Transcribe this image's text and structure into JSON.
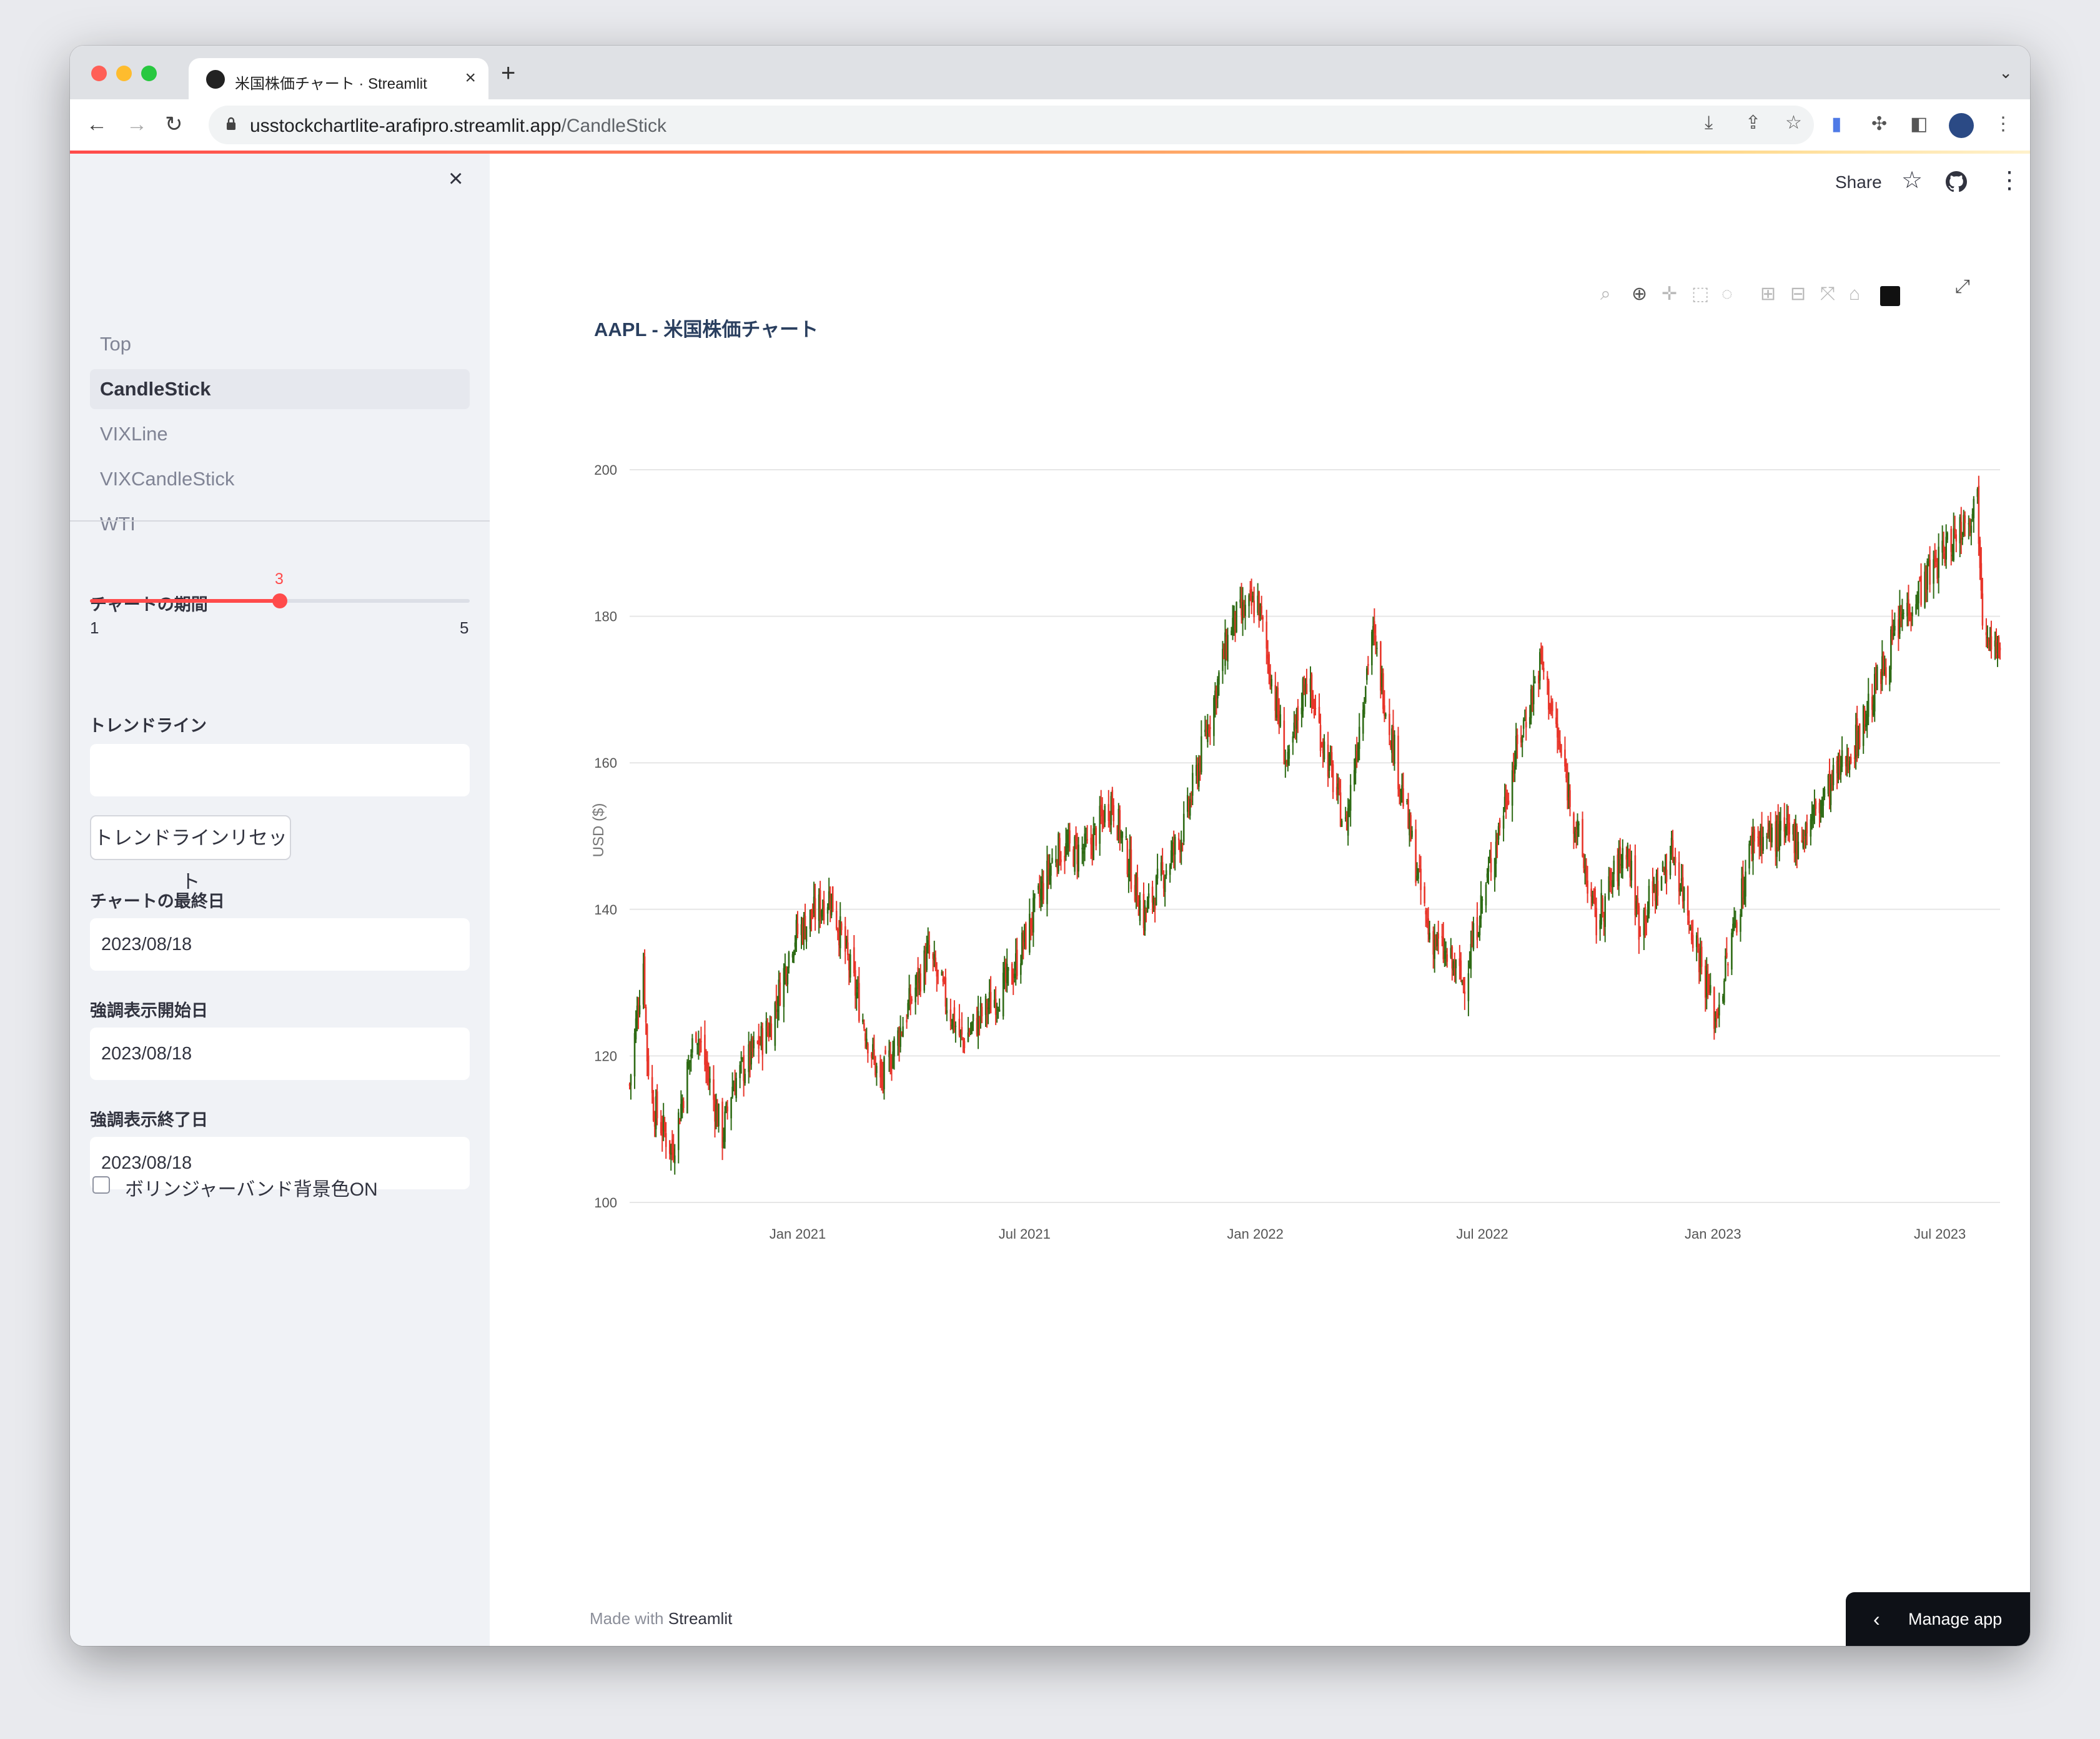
{
  "browser": {
    "tab_title": "米国株価チャート · Streamlit",
    "tab_close": "×",
    "new_tab": "+",
    "tab_menu": "⌄",
    "url_host": "usstockchartlite-arafipro.streamlit.app",
    "url_path": "/CandleStick"
  },
  "sidebar": {
    "close": "×",
    "nav": [
      {
        "label": "Top"
      },
      {
        "label": "CandleStick",
        "active": true
      },
      {
        "label": "VIXLine"
      },
      {
        "label": "VIXCandleStick"
      },
      {
        "label": "WTI"
      }
    ],
    "period": {
      "label": "チャートの期間",
      "value": 3,
      "min": 1,
      "max": 5,
      "min_label": "1",
      "max_label": "5",
      "value_label": "3"
    },
    "trendline": {
      "label": "トレンドライン",
      "value": ""
    },
    "reset_button": "トレンドラインリセット",
    "end_date": {
      "label": "チャートの最終日",
      "value": "2023/08/18"
    },
    "hl_start": {
      "label": "強調表示開始日",
      "value": "2023/08/18"
    },
    "hl_end": {
      "label": "強調表示終了日",
      "value": "2023/08/18"
    },
    "bollinger": {
      "label": "ボリンジャーバンド背景色ON",
      "checked": false
    }
  },
  "header": {
    "share": "Share"
  },
  "footer": {
    "made_with": "Made with ",
    "brand": "Streamlit"
  },
  "manage_app": {
    "label": "Manage app",
    "chevron": "‹"
  },
  "colors": {
    "accent": "#ff4b4b",
    "up": "#2e6b15",
    "down": "#e8352a",
    "grid": "#e6e6e6"
  },
  "chart_data": {
    "type": "candlestick",
    "title": "AAPL - 米国株価チャート",
    "ylabel": "USD ($)",
    "ylim": [
      100,
      200
    ],
    "yticks": [
      100,
      120,
      140,
      160,
      180,
      200
    ],
    "x_range": [
      "2020-08-20",
      "2023-08-18"
    ],
    "xticks": [
      {
        "date": "2021-01-01",
        "label": "Jan 2021"
      },
      {
        "date": "2021-07-01",
        "label": "Jul 2021"
      },
      {
        "date": "2022-01-01",
        "label": "Jan 2022"
      },
      {
        "date": "2022-07-01",
        "label": "Jul 2022"
      },
      {
        "date": "2023-01-01",
        "label": "Jan 2023"
      },
      {
        "date": "2023-07-01",
        "label": "Jul 2023"
      }
    ],
    "close_path": [
      [
        "2020-08-20",
        116
      ],
      [
        "2020-08-26",
        126
      ],
      [
        "2020-08-31",
        133
      ],
      [
        "2020-09-03",
        120
      ],
      [
        "2020-09-08",
        113
      ],
      [
        "2020-09-23",
        107
      ],
      [
        "2020-10-12",
        124
      ],
      [
        "2020-11-02",
        109
      ],
      [
        "2020-11-10",
        116
      ],
      [
        "2020-12-10",
        124
      ],
      [
        "2020-12-28",
        136
      ],
      [
        "2021-01-27",
        142
      ],
      [
        "2021-03-08",
        116
      ],
      [
        "2021-04-15",
        134
      ],
      [
        "2021-05-12",
        122
      ],
      [
        "2021-06-21",
        131
      ],
      [
        "2021-07-26",
        148
      ],
      [
        "2021-08-20",
        148
      ],
      [
        "2021-09-08",
        155
      ],
      [
        "2021-10-04",
        139
      ],
      [
        "2021-11-05",
        151
      ],
      [
        "2021-12-13",
        179
      ],
      [
        "2022-01-03",
        182
      ],
      [
        "2022-01-27",
        159
      ],
      [
        "2022-02-10",
        172
      ],
      [
        "2022-03-14",
        151
      ],
      [
        "2022-04-04",
        178
      ],
      [
        "2022-05-19",
        137
      ],
      [
        "2022-06-16",
        130
      ],
      [
        "2022-07-29",
        162
      ],
      [
        "2022-08-17",
        174
      ],
      [
        "2022-09-30",
        138
      ],
      [
        "2022-10-24",
        149
      ],
      [
        "2022-11-03",
        138
      ],
      [
        "2022-11-30",
        148
      ],
      [
        "2023-01-03",
        125
      ],
      [
        "2023-02-02",
        150
      ],
      [
        "2023-03-13",
        150
      ],
      [
        "2023-04-25",
        163
      ],
      [
        "2023-06-01",
        180
      ],
      [
        "2023-07-31",
        196
      ],
      [
        "2023-08-04",
        181
      ],
      [
        "2023-08-18",
        174
      ]
    ]
  }
}
